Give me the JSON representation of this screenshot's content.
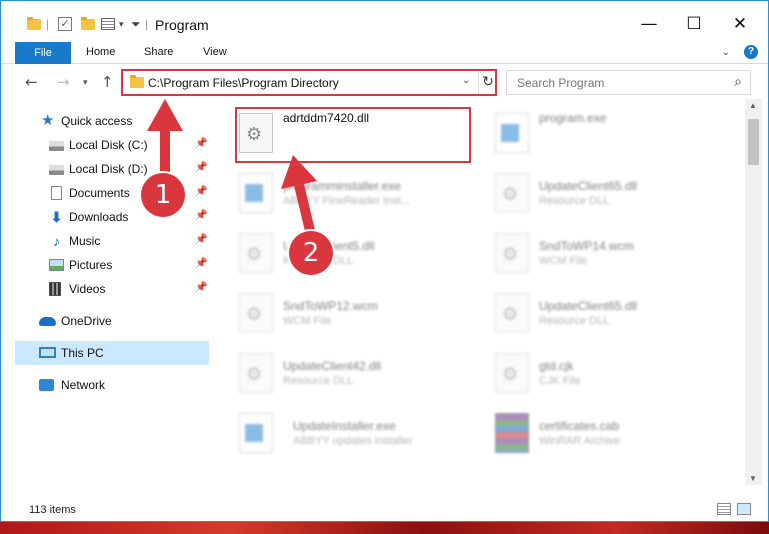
{
  "window": {
    "title": "Program",
    "controls": {
      "minimize": "—",
      "maximize": "☐",
      "close": "✕"
    }
  },
  "ribbon": {
    "tabs": [
      "File",
      "Home",
      "Share",
      "View"
    ]
  },
  "address": {
    "path": "C:\\Program Files\\Program Directory",
    "search_placeholder": "Search Program"
  },
  "sidebar": {
    "items": [
      {
        "label": "Quick access",
        "icon": "star-icon",
        "pinned": false
      },
      {
        "label": "Local Disk (C:)",
        "icon": "drive-icon",
        "pinned": true
      },
      {
        "label": "Local Disk (D:)",
        "icon": "drive-icon",
        "pinned": true
      },
      {
        "label": "Documents",
        "icon": "documents-icon",
        "pinned": true
      },
      {
        "label": "Downloads",
        "icon": "download-icon",
        "pinned": true
      },
      {
        "label": "Music",
        "icon": "music-icon",
        "pinned": true
      },
      {
        "label": "Pictures",
        "icon": "pictures-icon",
        "pinned": true
      },
      {
        "label": "Videos",
        "icon": "videos-icon",
        "pinned": true
      },
      {
        "label": "OneDrive",
        "icon": "cloud-icon",
        "pinned": false
      },
      {
        "label": "This PC",
        "icon": "computer-icon",
        "pinned": false,
        "selected": true
      },
      {
        "label": "Network",
        "icon": "network-icon",
        "pinned": false
      }
    ]
  },
  "files": [
    {
      "name": "adrtddm7420.dll",
      "type": "",
      "icon": "dll-icon",
      "highlight": true
    },
    {
      "name": "program.exe",
      "type": "",
      "icon": "exe-icon"
    },
    {
      "name": "programminstaller.exe",
      "type": "ABBYY FineReader Inst...",
      "icon": "exe-icon"
    },
    {
      "name": "UpdateClient65.dll",
      "type": "Resource DLL",
      "icon": "dll-icon"
    },
    {
      "name": "UpdateClient5.dll",
      "type": "Resource DLL",
      "icon": "dll-icon"
    },
    {
      "name": "SndToWP14.wcm",
      "type": "WCM File",
      "icon": "file-icon"
    },
    {
      "name": "SndToWP12.wcm",
      "type": "WCM File",
      "icon": "file-icon"
    },
    {
      "name": "UpdateClient65.dll",
      "type": "Resource DLL",
      "icon": "dll-icon"
    },
    {
      "name": "UpdateClient42.dll",
      "type": "Resource DLL",
      "icon": "dll-icon"
    },
    {
      "name": "gtd.cjk",
      "type": "CJK File",
      "icon": "file-icon"
    },
    {
      "name": "UpdateInstaller.exe",
      "type": "ABBYY updates installer",
      "icon": "exe-icon"
    },
    {
      "name": "certificates.cab",
      "type": "WinRAR Archive",
      "icon": "archive-icon"
    }
  ],
  "status": {
    "count": "113 items"
  },
  "annotations": {
    "step1": "1",
    "step2": "2",
    "color": "#d9363e"
  }
}
